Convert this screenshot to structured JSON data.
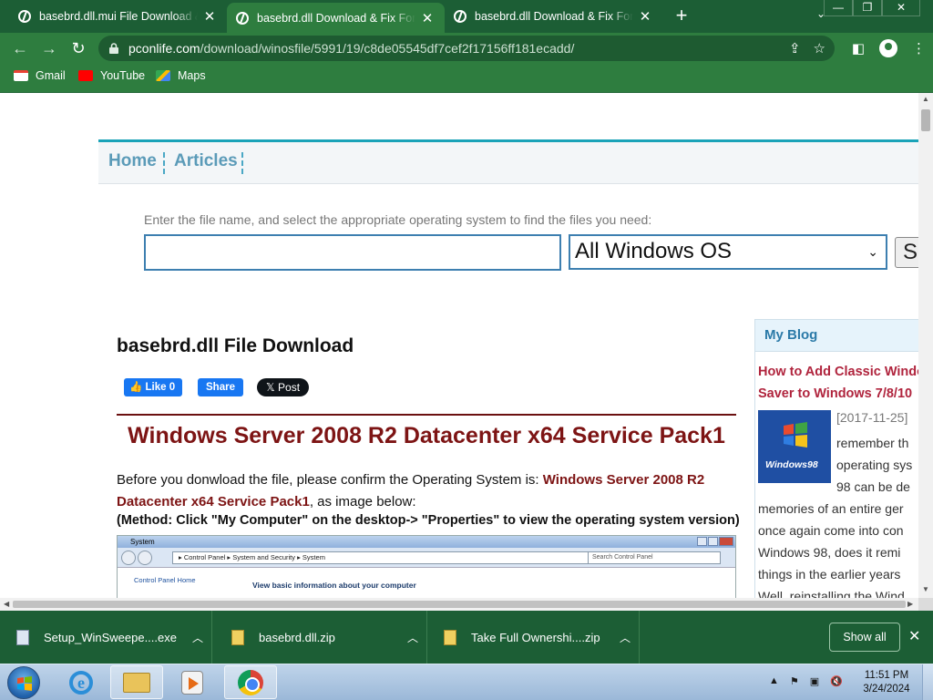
{
  "browser": {
    "tabs": [
      {
        "title": "basebrd.dll.mui File Download &",
        "active": false
      },
      {
        "title": "basebrd.dll Download & Fix For W",
        "active": true
      },
      {
        "title": "basebrd.dll Download & Fix For W",
        "active": false
      }
    ],
    "url_host": "pconlife.com",
    "url_path": "/download/winosfile/5991/19/c8de05545df7cef2f17156ff181ecadd/",
    "bookmarks": [
      {
        "label": "Gmail",
        "icon": "gmail-icon"
      },
      {
        "label": "YouTube",
        "icon": "youtube-icon"
      },
      {
        "label": "Maps",
        "icon": "maps-icon"
      }
    ],
    "colors": {
      "frame": "#1c5e35",
      "toolbar": "#2e7d3f"
    }
  },
  "page": {
    "nav": {
      "home": "Home",
      "articles": "Articles"
    },
    "search": {
      "hint": "Enter the file name, and select the appropriate operating system to find the files you need:",
      "value": "",
      "os_selected": "All Windows OS",
      "button_label": "S"
    },
    "title": "basebrd.dll File Download",
    "social": {
      "like": "Like 0",
      "share": "Share",
      "post": "Post"
    },
    "os_heading": "Windows Server 2008 R2 Datacenter x64 Service Pack1",
    "confirm_prefix": "Before you donwload the file, please confirm the Operating System is: ",
    "confirm_os": "Windows Server 2008 R2 Datacenter x64 Service Pack1",
    "confirm_suffix": ", as image below:",
    "method": "(Method: Click \"My Computer\" on the desktop-> \"Properties\" to view the operating system version)",
    "screenshot": {
      "window_title": "System",
      "path": "▸ Control Panel ▸ System and Security ▸ System",
      "search_placeholder": "Search Control Panel",
      "left_link": "Control Panel Home",
      "info": "View basic information about your computer"
    },
    "blog": {
      "heading": "My Blog",
      "link_line1": "How to Add Classic Windo",
      "link_line2": "Saver to Windows 7/8/10",
      "thumb_label": "Windows98",
      "date": "[2017-11-25]",
      "text_lines_short": [
        "remember th",
        "operating sys",
        "98 can be de"
      ],
      "text_lines_long": [
        "memories of an entire ger",
        "once again come into con",
        "Windows 98, does it remi",
        "things in the earlier years",
        "Well, reinstalling the Wind"
      ]
    },
    "accent_colors": {
      "heading_red": "#7d1414",
      "nav_blue": "#5b9bb8",
      "blog_link": "#b0243d"
    }
  },
  "downloads": {
    "items": [
      {
        "name": "Setup_WinSweepe....exe",
        "type": "exe"
      },
      {
        "name": "basebrd.dll.zip",
        "type": "zip"
      },
      {
        "name": "Take Full Ownershi....zip",
        "type": "zip"
      }
    ],
    "show_all": "Show all"
  },
  "taskbar": {
    "apps": [
      "internet-explorer-icon",
      "file-explorer-icon",
      "media-player-icon",
      "chrome-icon"
    ],
    "time": "11:51 PM",
    "date": "3/24/2024"
  }
}
